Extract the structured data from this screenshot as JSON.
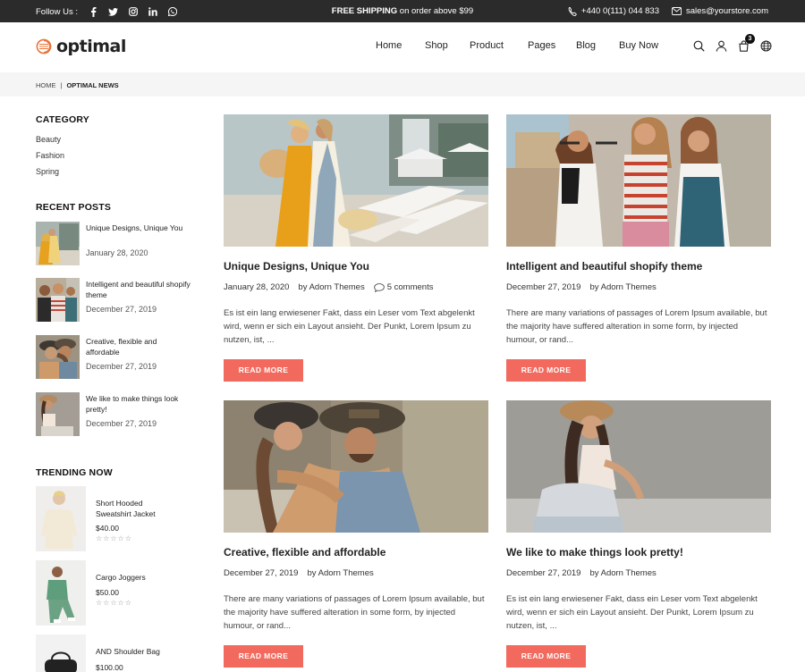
{
  "topbar": {
    "follow_label": "Follow Us :",
    "social_icons": [
      "facebook-icon",
      "twitter-icon",
      "instagram-icon",
      "linkedin-icon",
      "whatsapp-icon"
    ],
    "promo_bold": "FREE SHIPPING",
    "promo_rest": " on order above $99",
    "phone": "+440 0(111) 044 833",
    "email": "sales@yourstore.com"
  },
  "header": {
    "logo_text": "optimal",
    "nav": [
      "Home",
      "Shop",
      "Product",
      "Pages",
      "Blog",
      "Buy Now"
    ],
    "cart_count": "3",
    "icons": [
      "search-icon",
      "user-icon",
      "cart-icon",
      "globe-icon"
    ]
  },
  "breadcrumb": {
    "home": "HOME",
    "separator": "|",
    "current": "OPTIMAL NEWS"
  },
  "sidebar": {
    "category_title": "CATEGORY",
    "categories": [
      "Beauty",
      "Fashion",
      "Spring"
    ],
    "recent_title": "RECENT POSTS",
    "recent_posts": [
      {
        "title": "Unique Designs, Unique You",
        "date": "January 28, 2020"
      },
      {
        "title": "Intelligent and beautiful shopify theme",
        "date": "December 27, 2019"
      },
      {
        "title": "Creative, flexible and affordable",
        "date": "December 27, 2019"
      },
      {
        "title": "We like to make things look pretty!",
        "date": "December 27, 2019"
      }
    ],
    "trending_title": "TRENDING NOW",
    "trending": [
      {
        "name": "Short Hooded Sweatshirt Jacket",
        "price": "$40.00",
        "stars": "☆☆☆☆☆"
      },
      {
        "name": "Cargo Joggers",
        "price": "$50.00",
        "stars": "☆☆☆☆☆"
      },
      {
        "name": "AND Shoulder Bag",
        "price": "$100.00",
        "stars": "☆☆☆☆☆"
      }
    ]
  },
  "posts": [
    {
      "title": "Unique Designs, Unique You",
      "date": "January 28, 2020",
      "author": "by Adorn Themes",
      "comments": "5 comments",
      "excerpt": "Es ist ein lang erwiesener Fakt, dass ein Leser vom Text abgelenkt wird, wenn er sich ein Layout ansieht. Der Punkt, Lorem Ipsum zu nutzen, ist, ...",
      "button": "READ MORE"
    },
    {
      "title": "Intelligent and beautiful shopify theme",
      "date": "December 27, 2019",
      "author": "by Adorn Themes",
      "comments": "",
      "excerpt": "There are many variations of passages of Lorem Ipsum available, but the majority have suffered alteration in some form, by injected humour, or rand...",
      "button": "READ MORE"
    },
    {
      "title": "Creative, flexible and affordable",
      "date": "December 27, 2019",
      "author": "by Adorn Themes",
      "comments": "",
      "excerpt": "There are many variations of passages of Lorem Ipsum available, but the majority have suffered alteration in some form, by injected humour, or rand...",
      "button": "READ MORE"
    },
    {
      "title": "We like to make things look pretty!",
      "date": "December 27, 2019",
      "author": "by Adorn Themes",
      "comments": "",
      "excerpt": "Es ist ein lang erwiesener Fakt, dass ein Leser vom Text abgelenkt wird, wenn er sich ein Layout ansieht. Der Punkt, Lorem Ipsum zu nutzen, ist, ...",
      "button": "READ MORE"
    }
  ],
  "colors": {
    "topbar_bg": "#2b2b2b",
    "accent": "#f26a5e",
    "breadcrumb_bg": "#f5f5f5",
    "logo_accent": "#e8743b"
  }
}
